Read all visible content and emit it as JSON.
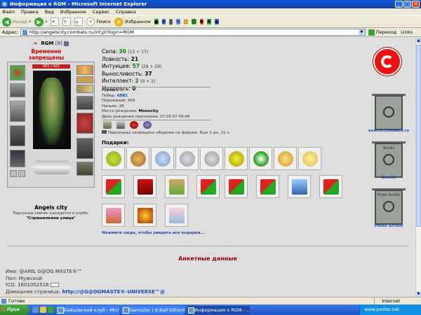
{
  "window": {
    "title": "Информация о RGM - Microsoft Internet Explorer"
  },
  "menu": [
    "Файл",
    "Правка",
    "Вид",
    "Избранное",
    "Сервис",
    "Справка"
  ],
  "toolbar": {
    "back": "Назад",
    "search": "Поиск",
    "favorites": "Избранное"
  },
  "address": {
    "label": "Адрес:",
    "url": "http://angelscity.combats.ru/inf.pl?login=RGM",
    "go": "Переход",
    "links": "Links"
  },
  "profile": {
    "name": "RGM",
    "level": "[8]",
    "banned": "Временно запрещены передачи!",
    "hp": "401 / 401",
    "city": "Angels city",
    "club_line": "Персонаж сейчас находится в клубе.",
    "location": "\"Страшилкина улица\""
  },
  "stats": [
    {
      "label": "Сила:",
      "value": "30",
      "extra": "(13 + 17)"
    },
    {
      "label": "Ловкость:",
      "value": "21",
      "extra": ""
    },
    {
      "label": "Интуиция:",
      "value": "57",
      "extra": "(28 + 29)"
    },
    {
      "label": "Выносливость:",
      "value": "37",
      "extra": ""
    },
    {
      "label": "Интеллект:",
      "value": "2",
      "extra": "(0 + 2)"
    },
    {
      "label": "Мудрость:",
      "value": "0",
      "extra": ""
    }
  ],
  "info": {
    "level_label": "Уровень:",
    "level": "8",
    "wins_label": "Побед:",
    "wins": "6881",
    "losses_label": "Поражений:",
    "losses": "959",
    "draws_label": "Ничьих:",
    "draws": "28",
    "birthplace_label": "Место рождения:",
    "birthplace": "Mooncity",
    "birthday_label": "День рождения персонажа:",
    "birthday": "07.05.07 09:48"
  },
  "warning": "Персонажу запрещено общение на форуме. Еще 2 дн. 21 ч.",
  "gifts": {
    "label": "Подарки:",
    "more_link": "Нажмите сюда, чтобы увидеть все подарки..."
  },
  "anketa_title": "Анкетные данные",
  "personal": {
    "name_label": "Имя:",
    "name": "@AMIL G@OG MASTE®™",
    "sex_label": "Пол:",
    "sex": "Мужской",
    "icq_label": "ICQ:",
    "icq": "1601052516",
    "homepage_label": "Домашняя страница:",
    "homepage": "http://@G@OGMASTE®-UNIVERSE™@"
  },
  "sidebar": {
    "banner1": "events.combats.ru",
    "banner2": "Scrolls",
    "banner3": "Photo Scrolls",
    "banner2_inner": "Scrolls",
    "banner3_inner": "Photo Scrolls"
  },
  "status": {
    "text": "Готово",
    "zone": "Internet"
  },
  "taskbar": {
    "start": "Пуск",
    "tasks": [
      "Бойцовский клуб - Micr...",
      "GameZer | 8-Ball billiards...",
      "Информация о RGM - ..."
    ],
    "tray": "www.poster.net"
  }
}
